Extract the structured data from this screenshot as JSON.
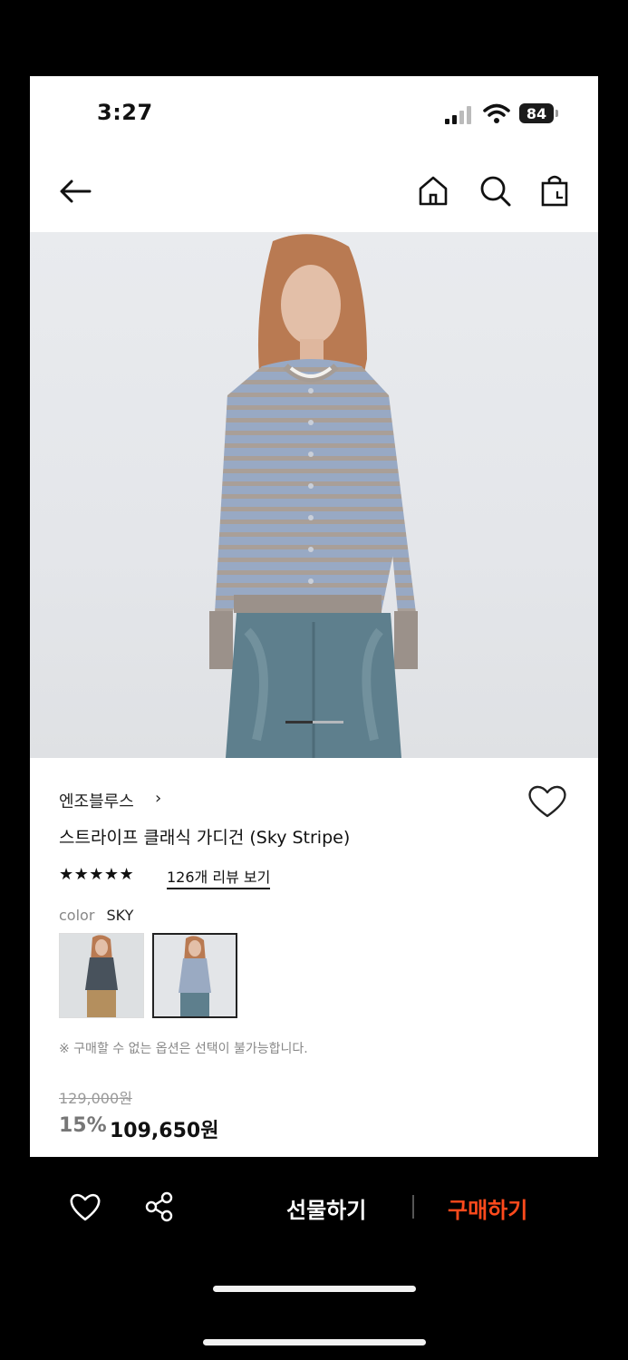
{
  "status_bar": {
    "time": "3:27",
    "battery": "84"
  },
  "nav": {
    "icons": [
      "arrow-left-icon",
      "home-icon",
      "search-icon",
      "shopping-bag-icon"
    ]
  },
  "product": {
    "brand": "엔조블루스",
    "brand_chevron": "›",
    "name": "스트라이프 클래식 가디건 (Sky Stripe)",
    "rating_stars": "★★★★★",
    "rating": 5,
    "reviews_link": "126개 리뷰 보기",
    "color_label": "color",
    "color_value": "SKY",
    "notice": "※ 구매할 수 없는 옵션은 선택이 불가능합니다.",
    "original_price": "129,000원",
    "discount": "15%",
    "sale_price": "109,650원"
  },
  "bottom_bar": {
    "gift_label": "선물하기",
    "buy_label": "구매하기"
  },
  "colors": {
    "accent": "#ff4a1c",
    "background": "#ffffff",
    "frame": "#000000"
  }
}
